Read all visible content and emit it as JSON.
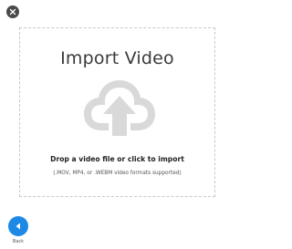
{
  "close_button": {
    "icon": "close-icon"
  },
  "drop_zone": {
    "title": "Import Video",
    "icon": "cloud-upload-icon",
    "main_text": "Drop a video file or click to import",
    "sub_text": "(.MOV, MP4, or .WEBM video formats supported)"
  },
  "back_button": {
    "icon": "arrow-left-icon",
    "label": "Back"
  },
  "colors": {
    "accent": "#1e88e5",
    "close_bg": "#4a4a4a",
    "dashed_border": "#c8c8c8",
    "icon_gray": "#d9d9d9"
  }
}
